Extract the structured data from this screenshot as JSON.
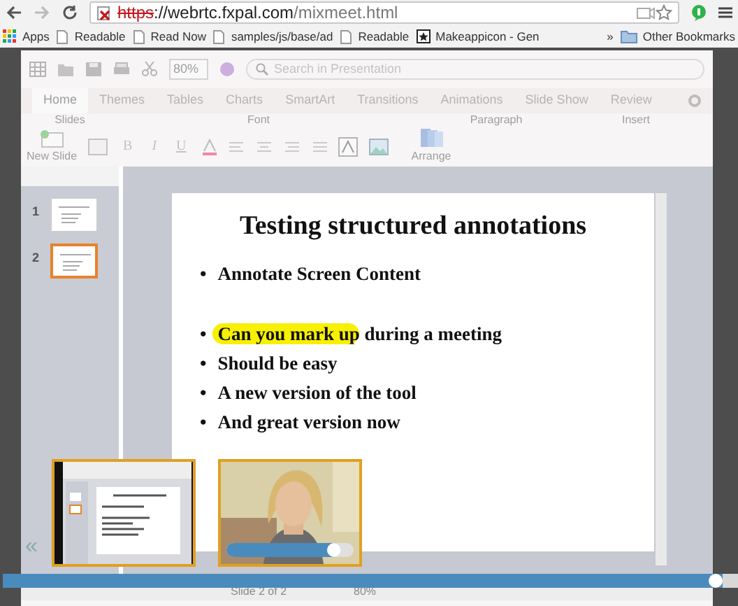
{
  "browser": {
    "address": {
      "scheme": "https",
      "host": "://webrtc.fxpal.com",
      "path": "/mixmeet.html"
    },
    "bookmarks": [
      {
        "label": "Apps",
        "kind": "apps"
      },
      {
        "label": "Readable",
        "kind": "page"
      },
      {
        "label": "Read Now",
        "kind": "page"
      },
      {
        "label": "samples/js/base/ad",
        "kind": "page"
      },
      {
        "label": "Readable",
        "kind": "page"
      },
      {
        "label": "Makeappicon - Gen",
        "kind": "app"
      }
    ],
    "overflow": "»",
    "other_bookmarks": "Other Bookmarks"
  },
  "toolbar": {
    "zoom": "80%",
    "search_placeholder": "Search in Presentation"
  },
  "ribbon_tabs": [
    {
      "label": "Home",
      "selected": true
    },
    {
      "label": "Themes",
      "selected": false
    },
    {
      "label": "Tables",
      "selected": false
    },
    {
      "label": "Charts",
      "selected": false
    },
    {
      "label": "SmartArt",
      "selected": false
    },
    {
      "label": "Transitions",
      "selected": false
    },
    {
      "label": "Animations",
      "selected": false
    },
    {
      "label": "Slide Show",
      "selected": false
    },
    {
      "label": "Review",
      "selected": false
    }
  ],
  "ribbon_groups": [
    "Slides",
    "Font",
    "Paragraph",
    "Insert"
  ],
  "ribbon_buttons": {
    "new_slide": "New Slide",
    "arrange": "Arrange",
    "format": [
      "B",
      "I",
      "U"
    ]
  },
  "slides_pane": [
    {
      "number": "1",
      "selected": false
    },
    {
      "number": "2",
      "selected": true
    }
  ],
  "slide": {
    "title": "Testing structured annotations",
    "bullet_groups": [
      [
        {
          "bullet": "•",
          "text": "Annotate Screen Content"
        }
      ],
      [
        {
          "bullet": "•",
          "highlight": "Can you mark up",
          "text": "during a meeting"
        },
        {
          "bullet": "•",
          "text": "Should be easy"
        },
        {
          "bullet": "•",
          "text": "A new version of the tool"
        },
        {
          "bullet": "•",
          "text": "And great version now"
        }
      ]
    ]
  },
  "video_tiles": [
    {
      "kind": "screen"
    },
    {
      "kind": "camera",
      "level": 0.9
    }
  ],
  "collapse": "«",
  "timeline": {
    "level": 0.98
  },
  "status_bar": {
    "slide": "Slide 2 of 2",
    "zoom": "80%"
  }
}
